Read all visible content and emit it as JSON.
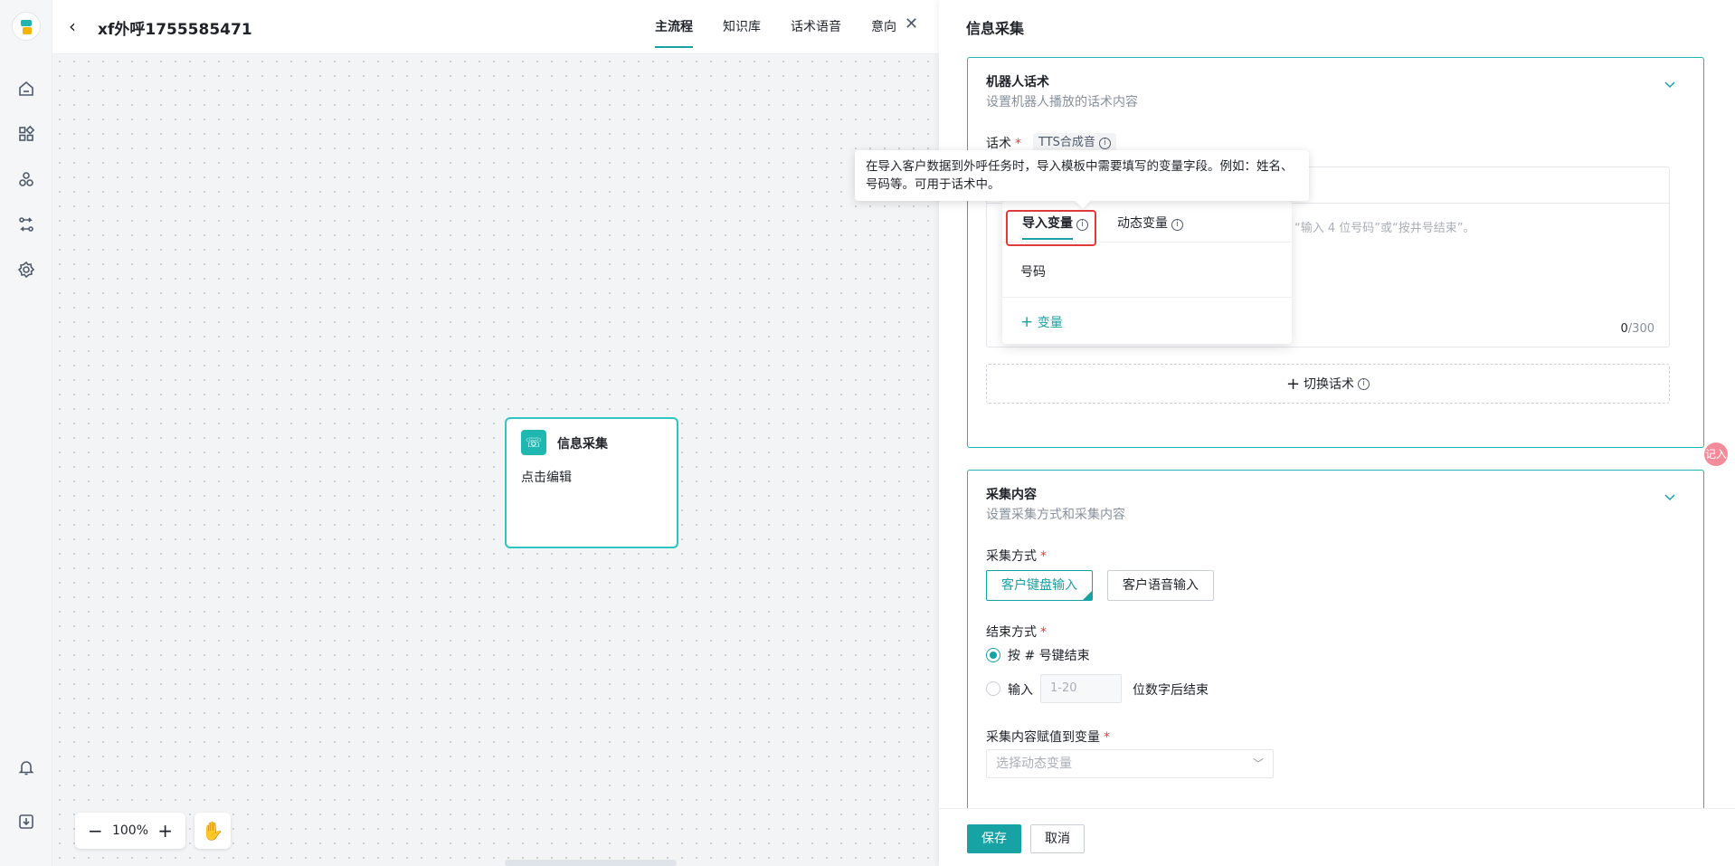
{
  "header": {
    "title": "xf外呼1755585471",
    "tabs": [
      {
        "label": "主流程",
        "active": true
      },
      {
        "label": "知识库",
        "active": false
      },
      {
        "label": "话术语音",
        "active": false
      },
      {
        "label": "意向",
        "active": false
      }
    ]
  },
  "canvas": {
    "node": {
      "title": "信息采集",
      "subtitle": "点击编辑"
    },
    "zoom": "100%"
  },
  "drawer": {
    "title": "信息采集",
    "robot_card": {
      "title": "机器人话术",
      "subtitle": "设置机器人播放的话术内容",
      "speech_label": "话术",
      "tts_tag": "TTS合成音",
      "placeholder": "“输入 4 位号码”或“按井号结束”。",
      "count": "0",
      "max": "/300",
      "switch_label": "切换话术"
    },
    "collect_card": {
      "title": "采集内容",
      "subtitle": "设置采集方式和采集内容",
      "method_label": "采集方式",
      "methods": [
        "客户键盘输入",
        "客户语音输入"
      ],
      "end_label": "结束方式",
      "end_options": [
        {
          "label": "按 # 号键结束",
          "checked": true
        },
        {
          "label": "输入",
          "checked": false
        }
      ],
      "digits_placeholder": "1-20",
      "digits_suffix": "位数字后结束",
      "assign_label": "采集内容赋值到变量",
      "assign_placeholder": "选择动态变量"
    },
    "footer": {
      "save": "保存",
      "cancel": "取消"
    }
  },
  "variable_dropdown": {
    "tabs": [
      "导入变量",
      "动态变量"
    ],
    "items": [
      "号码"
    ],
    "add_label": "变量"
  },
  "tooltip": "在导入客户数据到外呼任务时，导入模板中需要填写的变量字段。例如：姓名、号码等。可用于话术中。",
  "float_button": "记入",
  "colors": {
    "accent": "#17a2a4",
    "required": "#e63b3b",
    "highlight": "#e03b3b"
  }
}
